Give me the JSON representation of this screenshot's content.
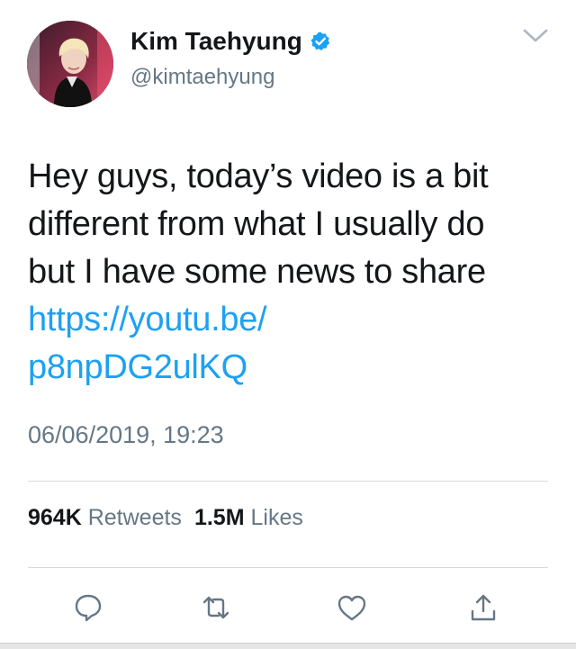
{
  "author": {
    "display_name": "Kim Taehyung",
    "handle": "@kimtaehyung",
    "verified": true,
    "avatar_icon": "profile-photo"
  },
  "tweet": {
    "text": "Hey guys, today’s video is a bit\ndifferent from what I usually do\nbut I have some news to share",
    "link": "https://youtu.be/\np8npDG2ulKQ",
    "timestamp": "06/06/2019, 19:23"
  },
  "stats": {
    "retweets_count": "964K",
    "retweets_label": "Retweets",
    "likes_count": "1.5M",
    "likes_label": "Likes"
  },
  "actions": [
    {
      "icon": "reply-icon"
    },
    {
      "icon": "retweet-icon"
    },
    {
      "icon": "like-icon"
    },
    {
      "icon": "share-icon"
    }
  ],
  "colors": {
    "link": "#1da1f2",
    "verified": "#1da1f2",
    "secondary_text": "#657786",
    "icon": "#657786",
    "divider": "#d6dbe0"
  }
}
